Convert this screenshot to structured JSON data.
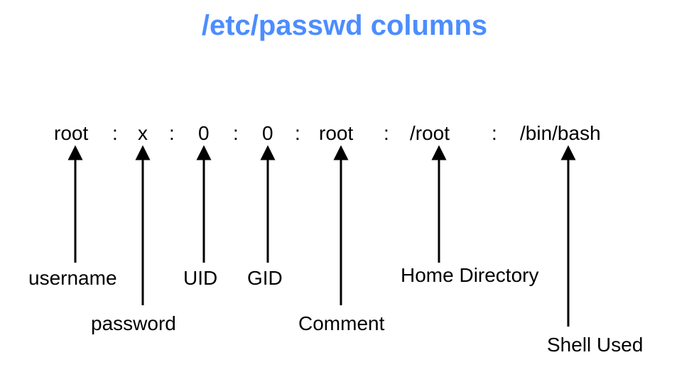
{
  "title": "/etc/passwd columns",
  "fields": {
    "f1": "root",
    "f2": "x",
    "f3": "0",
    "f4": "0",
    "f5": "root",
    "f6": "/root",
    "f7": "/bin/bash"
  },
  "separator": ":",
  "labels": {
    "username": "username",
    "password": "password",
    "uid": "UID",
    "gid": "GID",
    "comment": "Comment",
    "home": "Home Directory",
    "shell": "Shell Used"
  }
}
